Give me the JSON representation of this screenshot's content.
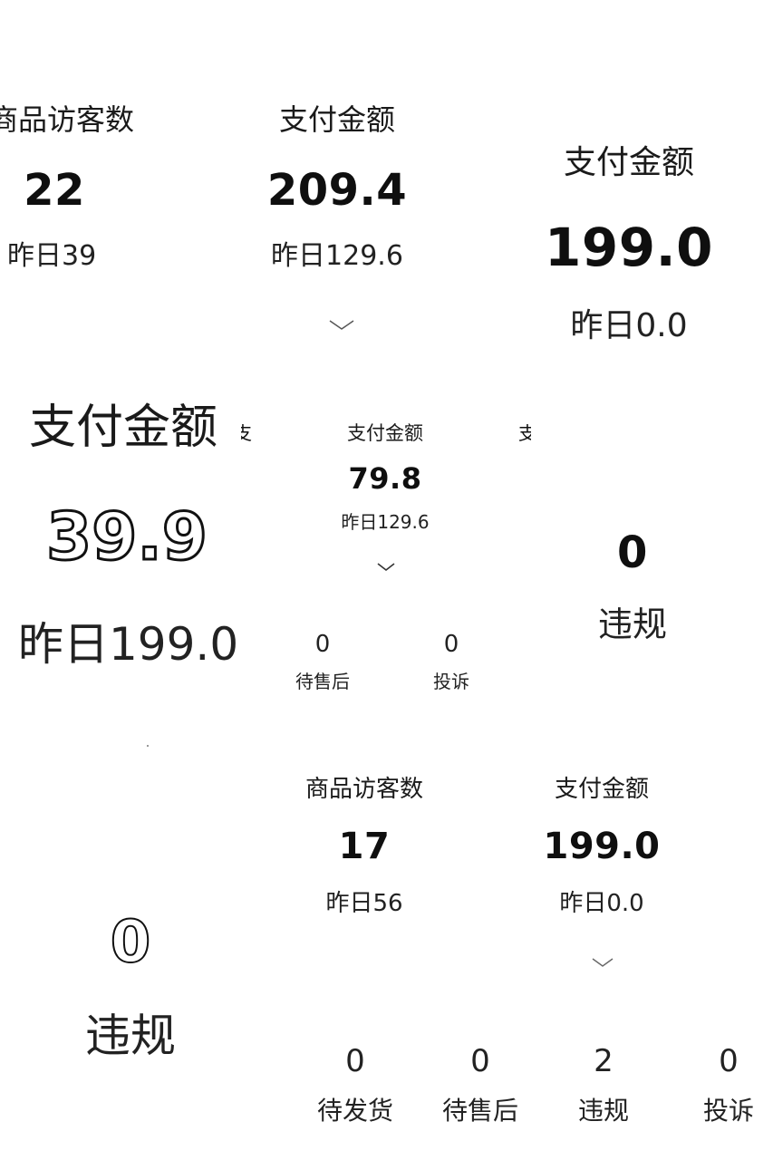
{
  "tile1": {
    "visitors_label": "商品访客数",
    "visitors_value": "22",
    "visitors_yesterday": "昨日39",
    "pay_label": "支付金额",
    "pay_value": "209.4",
    "pay_yesterday": "昨日129.6"
  },
  "tile2": {
    "pay_label": "支付金额",
    "pay_value": "199.0",
    "pay_yesterday": "昨日0.0"
  },
  "tile3": {
    "pay_label": "支付金额",
    "pay_value": "39.9",
    "pay_yesterday": "昨日199.0",
    "partial_left": "支",
    "partial_right": "支"
  },
  "tile4": {
    "pay_label": "支付金额",
    "pay_value": "79.8",
    "pay_yesterday": "昨日129.6",
    "after_sales_value": "0",
    "after_sales_label": "待售后",
    "complaint_value": "0",
    "complaint_label": "投诉"
  },
  "tile5": {
    "violation_value": "0",
    "violation_label": "违规"
  },
  "tile6": {
    "violation_value": "0",
    "violation_label": "违规"
  },
  "tile7": {
    "visitors_label": "商品访客数",
    "visitors_value": "17",
    "visitors_yesterday": "昨日56",
    "pay_label": "支付金额",
    "pay_value": "199.0",
    "pay_yesterday": "昨日0.0",
    "stats": [
      {
        "value": "0",
        "label": "待发货"
      },
      {
        "value": "0",
        "label": "待售后"
      },
      {
        "value": "2",
        "label": "违规"
      },
      {
        "value": "0",
        "label": "投诉"
      }
    ]
  },
  "icons": {
    "chevron": "chevron-down-icon"
  }
}
